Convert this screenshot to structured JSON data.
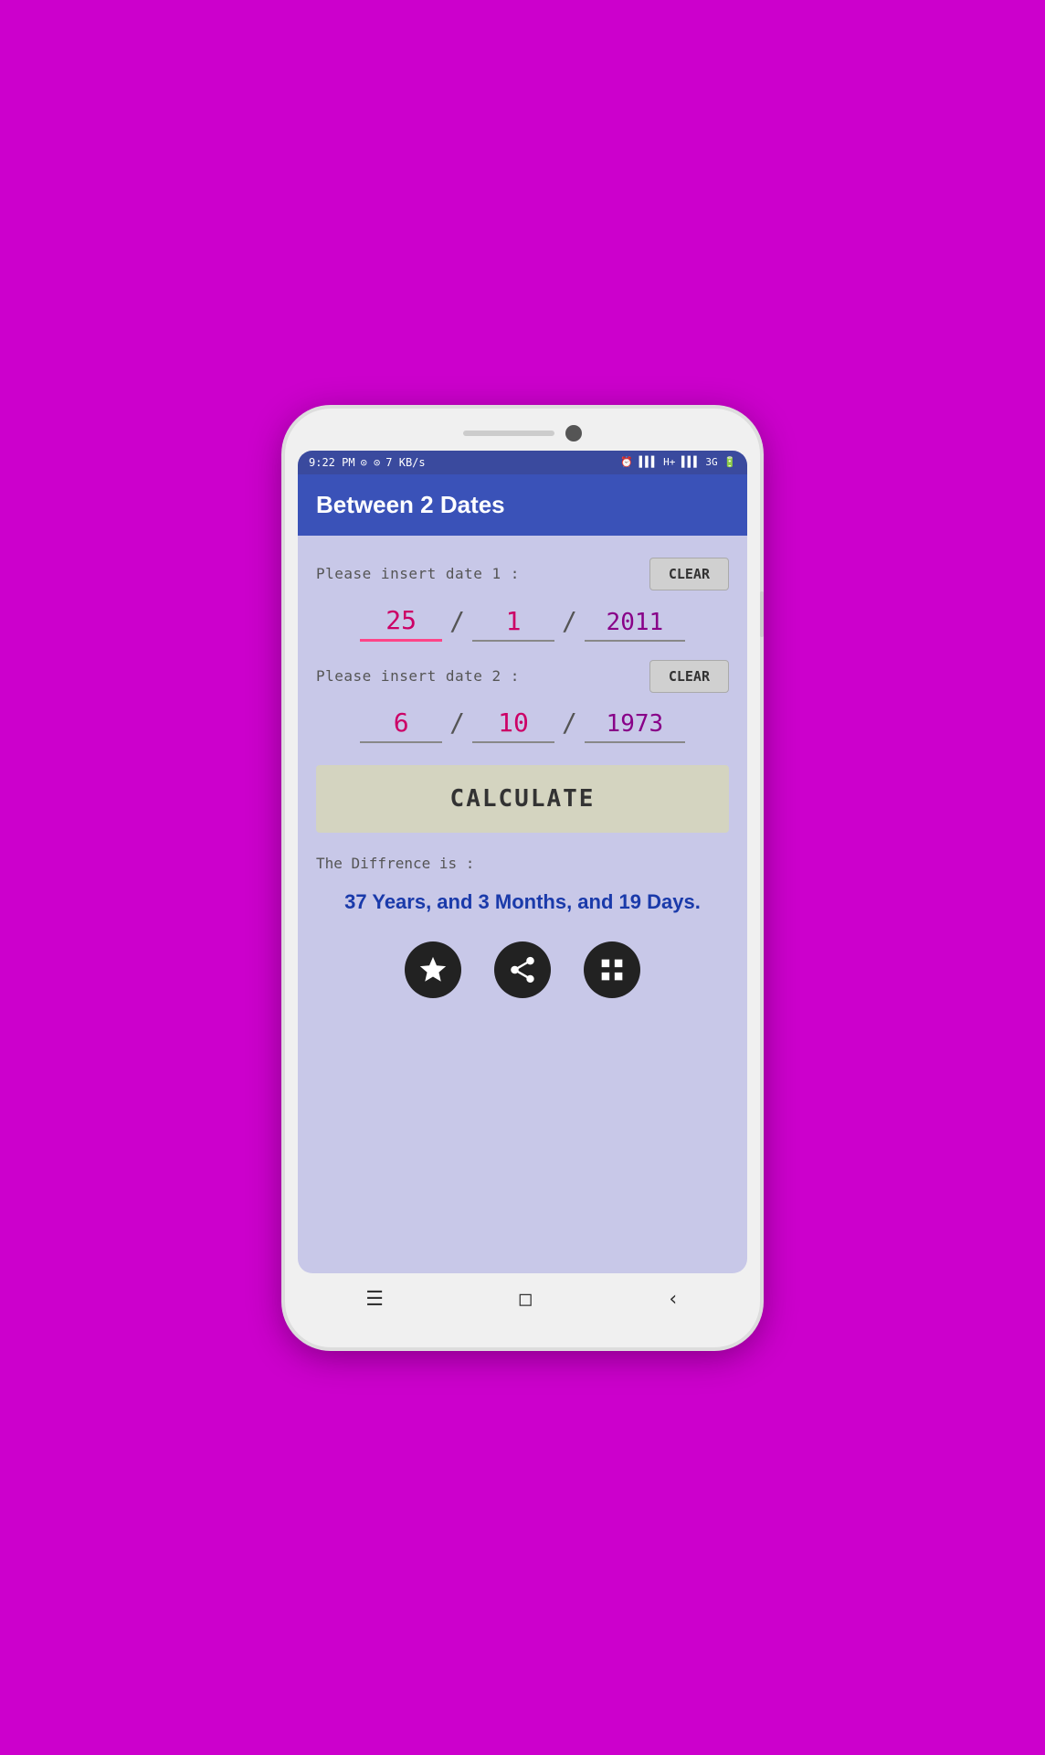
{
  "statusBar": {
    "time": "9:22 PM",
    "networkInfo": "7 KB/s",
    "rightIcons": "⏰ H+ 3G 🔋"
  },
  "header": {
    "title": "Between 2 Dates"
  },
  "date1": {
    "label": "Please insert date 1 :",
    "clearLabel": "CLEAR",
    "day": "25",
    "month": "1",
    "year": "2011"
  },
  "date2": {
    "label": "Please insert date 2 :",
    "clearLabel": "CLEAR",
    "day": "6",
    "month": "10",
    "year": "1973"
  },
  "calculateBtn": "CALCULATE",
  "result": {
    "label": "The Diffrence is :",
    "value": "37 Years, and 3 Months, and 19 Days."
  },
  "icons": {
    "favorite": "favorite-icon",
    "share": "share-icon",
    "grid": "grid-icon"
  },
  "nav": {
    "menu": "☰",
    "home": "□",
    "back": "‹"
  }
}
